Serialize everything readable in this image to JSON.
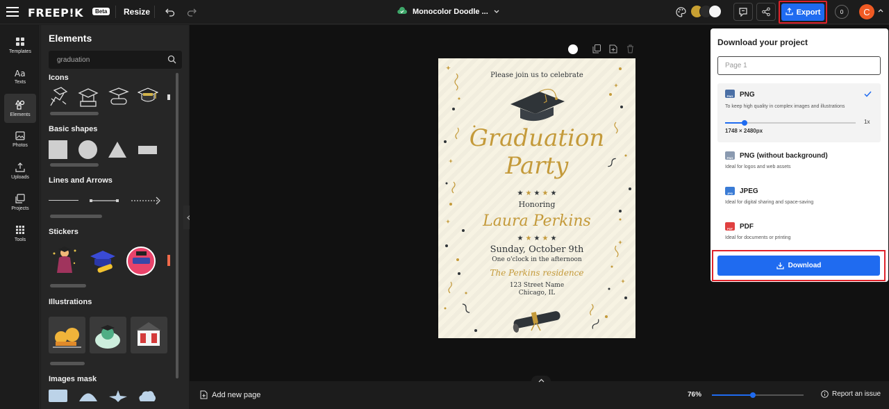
{
  "header": {
    "logo": "FREEP!K",
    "beta_badge": "Beta",
    "resize_label": "Resize",
    "project_name": "Monocolor Doodle ...",
    "export_label": "Export",
    "counter": "0",
    "avatar_initial": "C",
    "swatches": [
      "#c8a032",
      "#2b2b2b",
      "#f5f5f5"
    ]
  },
  "rail": {
    "items": [
      {
        "label": "Templates",
        "icon": "templates-icon"
      },
      {
        "label": "Texts",
        "icon": "text-icon"
      },
      {
        "label": "Elements",
        "icon": "elements-icon"
      },
      {
        "label": "Photos",
        "icon": "photos-icon"
      },
      {
        "label": "Uploads",
        "icon": "upload-icon"
      },
      {
        "label": "Projects",
        "icon": "projects-icon"
      },
      {
        "label": "Tools",
        "icon": "tools-icon"
      }
    ]
  },
  "panel": {
    "title": "Elements",
    "search_value": "graduation",
    "sections": {
      "icons": "Icons",
      "basic_shapes": "Basic shapes",
      "lines": "Lines and Arrows",
      "stickers": "Stickers",
      "illustrations": "Illustrations",
      "images_mask": "Images mask"
    }
  },
  "invitation": {
    "join_text": "Please join us to celebrate",
    "title_line1": "Graduation",
    "title_line2": "Party",
    "honoring": "Honoring",
    "name": "Laura Perkins",
    "date": "Sunday, October 9th",
    "time": "One o'clock in the afternoon",
    "venue": "The Perkins residence",
    "street": "123 Street Name",
    "city": "Chicago, IL",
    "gold": "#c49a3a",
    "dark": "#2f3438"
  },
  "bottom": {
    "add_page": "Add new page",
    "zoom": "76%",
    "zoom_fraction": 0.45,
    "report": "Report an issue"
  },
  "download": {
    "title": "Download your project",
    "page_placeholder": "Page 1",
    "options": [
      {
        "title": "PNG",
        "desc": "To keep high quality in complex images and illustrations",
        "badge": "PNG",
        "color": "#4a6fa5"
      },
      {
        "title": "PNG (without background)",
        "desc": "Ideal for logos and web assets",
        "badge": "PNG",
        "color": "#8a9ab0"
      },
      {
        "title": "JPEG",
        "desc": "Ideal for digital sharing and space-saving",
        "badge": "JPG",
        "color": "#3a7bd5"
      },
      {
        "title": "PDF",
        "desc": "Ideal for documents or printing",
        "badge": "PDF",
        "color": "#e04040"
      }
    ],
    "scale_label": "1x",
    "scale_fraction": 0.15,
    "dimensions": "1748 × 2480px",
    "button_label": "Download"
  }
}
